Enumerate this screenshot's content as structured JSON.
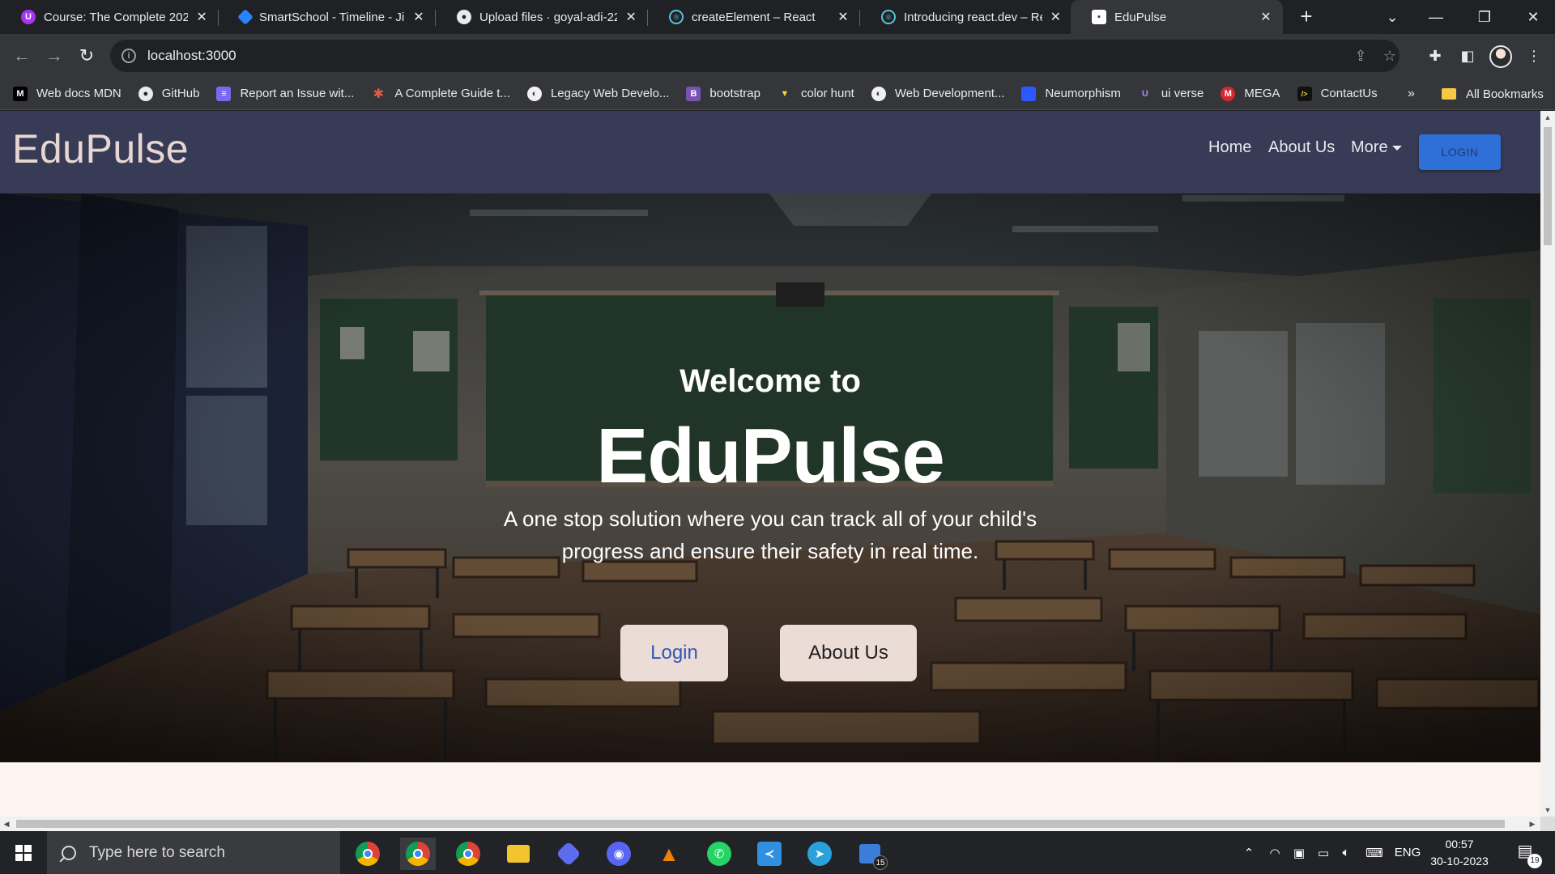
{
  "browser": {
    "tabs": [
      {
        "title": "Course: The Complete 202",
        "favicon": "udemy-icon",
        "favicon_color": "#a435f0"
      },
      {
        "title": "SmartSchool - Timeline - Ji",
        "favicon": "jira-icon",
        "favicon_color": "#2684ff"
      },
      {
        "title": "Upload files · goyal-adi-22",
        "favicon": "github-icon",
        "favicon_color": "#e8eaed"
      },
      {
        "title": "createElement – React",
        "favicon": "react-icon",
        "favicon_color": "#58c4dc"
      },
      {
        "title": "Introducing react.dev – Re",
        "favicon": "react-icon",
        "favicon_color": "#58c4dc"
      },
      {
        "title": "EduPulse",
        "favicon": "page-icon",
        "favicon_color": "#ffffff"
      }
    ],
    "active_tab_index": 5,
    "new_tab_label": "+",
    "url": "localhost:3000",
    "bookmarks": [
      {
        "label": "Web docs MDN",
        "icon": "mdn-icon",
        "color": "#000000",
        "glyph": "M"
      },
      {
        "label": "GitHub",
        "icon": "github-icon",
        "color": "#e8eaed",
        "glyph": "●"
      },
      {
        "label": "Report an Issue wit...",
        "icon": "list-icon",
        "color": "#7b68ee",
        "glyph": "≡"
      },
      {
        "label": "A Complete Guide t...",
        "icon": "asterisk-icon",
        "color": "#e05d44",
        "glyph": "✱"
      },
      {
        "label": "Legacy Web Develo...",
        "icon": "fcc-icon",
        "color": "#f1f1f1",
        "glyph": "◐"
      },
      {
        "label": "bootstrap",
        "icon": "bootstrap-icon",
        "color": "#7952b3",
        "glyph": "B"
      },
      {
        "label": "color hunt",
        "icon": "colorhunt-icon",
        "color": "#f5d742",
        "glyph": "▼"
      },
      {
        "label": "Web Development...",
        "icon": "fcc-icon",
        "color": "#f1f1f1",
        "glyph": "◐"
      },
      {
        "label": "Neumorphism",
        "icon": "neumorphism-icon",
        "color": "#2b59ff",
        "glyph": ""
      },
      {
        "label": "ui verse",
        "icon": "uiverse-icon",
        "color": "#8b5cf6",
        "glyph": "U"
      },
      {
        "label": "MEGA",
        "icon": "mega-icon",
        "color": "#d9272e",
        "glyph": "M"
      },
      {
        "label": "ContactUs",
        "icon": "terminal-icon",
        "color": "#111111",
        "glyph": "/>"
      }
    ],
    "bookmarks_overflow": "»",
    "all_bookmarks": "All Bookmarks"
  },
  "site": {
    "brand": "EduPulse",
    "nav": {
      "home": "Home",
      "about": "About Us",
      "more": "More",
      "login": "LOGIN"
    },
    "hero": {
      "subtitle": "Welcome to",
      "title": "EduPulse",
      "description": "A one stop solution where you can track all of your child's progress and ensure their safety in real time.",
      "login_button": "Login",
      "about_button": "About Us"
    }
  },
  "taskbar": {
    "search_placeholder": "Type here to search",
    "apps": [
      {
        "name": "chrome-icon",
        "color": "#4285f4"
      },
      {
        "name": "chrome-profile-icon",
        "color": "#4285f4"
      },
      {
        "name": "chrome-alt-icon",
        "color": "#34a853"
      },
      {
        "name": "file-explorer-icon",
        "color": "#f4c430"
      },
      {
        "name": "app-icon",
        "color": "#5b6cf0"
      },
      {
        "name": "discord-icon",
        "color": "#5865f2"
      },
      {
        "name": "vlc-icon",
        "color": "#f08000"
      },
      {
        "name": "whatsapp-icon",
        "color": "#25d366"
      },
      {
        "name": "vscode-icon",
        "color": "#2f8fe0"
      },
      {
        "name": "telegram-icon",
        "color": "#2aa1da"
      },
      {
        "name": "taskview-icon",
        "color": "#3b7dd8"
      }
    ],
    "taskview_badge": "15",
    "language": "ENG",
    "time": "00:57",
    "date": "30-10-2023",
    "notification_count": "19"
  }
}
